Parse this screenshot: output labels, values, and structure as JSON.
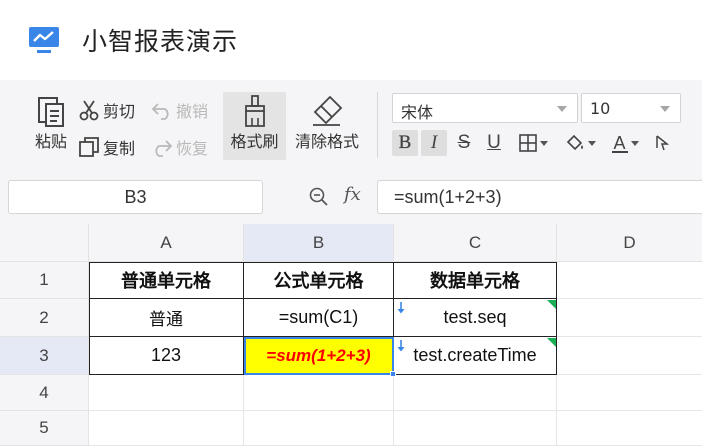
{
  "app": {
    "title": "小智报表演示",
    "logo_icon": "monitor-chart-icon",
    "accent": "#3a86e8"
  },
  "toolbar": {
    "paste": "粘贴",
    "cut": "剪切",
    "copy": "复制",
    "undo": "撤销",
    "redo": "恢复",
    "format_painter": "格式刷",
    "clear_format": "清除格式",
    "font_family": "宋体",
    "font_size": "10",
    "bold": "B",
    "italic": "I",
    "strike": "S",
    "underline": "U",
    "fill_color_icon": "paint-bucket-icon",
    "font_color": "A",
    "font_color_icon": "font-color-icon",
    "border_icon": "border-icon",
    "pointer_icon": "cursor-icon"
  },
  "formula_bar": {
    "cell_ref": "B3",
    "fx": "fx",
    "formula": "=sum(1+2+3)"
  },
  "grid": {
    "columns": [
      "A",
      "B",
      "C",
      "D"
    ],
    "rows": [
      "1",
      "2",
      "3",
      "4",
      "5"
    ],
    "selected_column": "B",
    "selected_row": "3",
    "cells": {
      "A1": "普通单元格",
      "B1": "公式单元格",
      "C1": "数据单元格",
      "A2": "普通",
      "B2": "=sum(C1)",
      "C2": "test.seq",
      "A3": "123",
      "B3": "=sum(1+2+3)",
      "C3": "test.createTime"
    },
    "highlight": {
      "fill": "#ffff00",
      "text": "#ff0000"
    },
    "marker_color": "#1aaf55"
  }
}
